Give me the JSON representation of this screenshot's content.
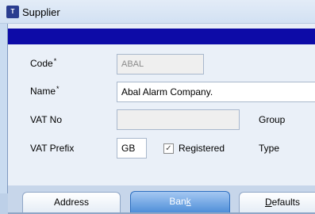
{
  "window": {
    "title": "Supplier",
    "icon": "app-icon"
  },
  "form": {
    "code": {
      "label": "Code",
      "required_mark": "*",
      "value": "ABAL"
    },
    "name": {
      "label": "Name",
      "required_mark": "*",
      "value": "Abal Alarm Company."
    },
    "vat_no": {
      "label": "VAT No",
      "value": ""
    },
    "group": {
      "label": "Group"
    },
    "vat_prefix": {
      "label": "VAT Prefix",
      "value": "GB"
    },
    "registered": {
      "label": "Registered",
      "checked": true,
      "check_glyph": "✓"
    },
    "type": {
      "label": "Type"
    }
  },
  "tabs": [
    {
      "label": "Address",
      "active": false
    },
    {
      "label_pre": "Ban",
      "label_key": "k",
      "label_post": "",
      "active": true
    },
    {
      "label_key": "D",
      "label_post": "efaults",
      "active": false
    }
  ],
  "colors": {
    "header_strip": "#0d0ba7",
    "active_tab": "#4f8fd9"
  }
}
